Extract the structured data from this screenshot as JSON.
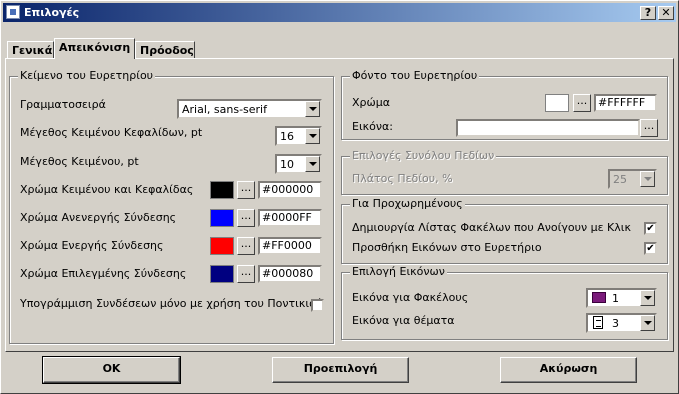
{
  "window": {
    "title": "Επιλογές",
    "help_btn": "?",
    "close_btn": "✕"
  },
  "tabs": [
    "Γενικά",
    "Απεικόνιση",
    "Πρόοδος"
  ],
  "index_text": {
    "title": "Κείμενο του Ευρετηρίου",
    "font_label": "Γραμματοσειρά",
    "font_value": "Arial, sans-serif",
    "header_size_label": "Μέγεθος Κειμένου Κεφαλίδων, pt",
    "header_size_value": "16",
    "text_size_label": "Μέγεθος Κειμένου, pt",
    "text_size_value": "10",
    "colors": [
      {
        "label": "Χρώμα Κειμένου και Κεφαλίδας",
        "hex": "#000000",
        "color": "#000000"
      },
      {
        "label": "Χρώμα Ανενεργής Σύνδεσης",
        "hex": "#0000FF",
        "color": "#0000ff"
      },
      {
        "label": "Χρώμα Ενεργής Σύνδεσης",
        "hex": "#FF0000",
        "color": "#ff0000"
      },
      {
        "label": "Χρώμα Επιλεγμένης Σύνδεσης",
        "hex": "#000080",
        "color": "#000080"
      }
    ],
    "underline_label": "Υπογράμμιση Συνδέσεων μόνο με χρήση του Ποντικιού",
    "underline_checked": false,
    "browse_label": "..."
  },
  "background": {
    "title": "Φόντο του Ευρετηρίου",
    "color_label": "Χρώμα",
    "color_hex": "#FFFFFF",
    "color": "#ffffff",
    "image_label": "Εικόνα:",
    "image_value": "",
    "browse_label": "..."
  },
  "field_options": {
    "title": "Επιλογές Συνόλου Πεδίων",
    "width_label": "Πλάτος Πεδίου, %",
    "width_value": "25"
  },
  "advanced": {
    "title": "Για Προχωρημένους",
    "items": [
      {
        "label": "Δημιουργία Λίστας Φακέλων που Ανοίγουν με Κλικ",
        "checked": true
      },
      {
        "label": "Προσθήκη Εικόνων στο Ευρετήριο",
        "checked": true
      }
    ]
  },
  "images": {
    "title": "Επιλογή Εικόνων",
    "folder_label": "Εικόνα για Φακέλους",
    "folder_value": "1",
    "folder_icon": "book-icon",
    "topic_label": "Εικόνα για θέματα",
    "topic_value": "3",
    "topic_icon": "page-icon"
  },
  "buttons": {
    "ok": "OK",
    "default": "Προεπιλογή",
    "cancel": "Ακύρωση"
  },
  "check_mark": "✔"
}
